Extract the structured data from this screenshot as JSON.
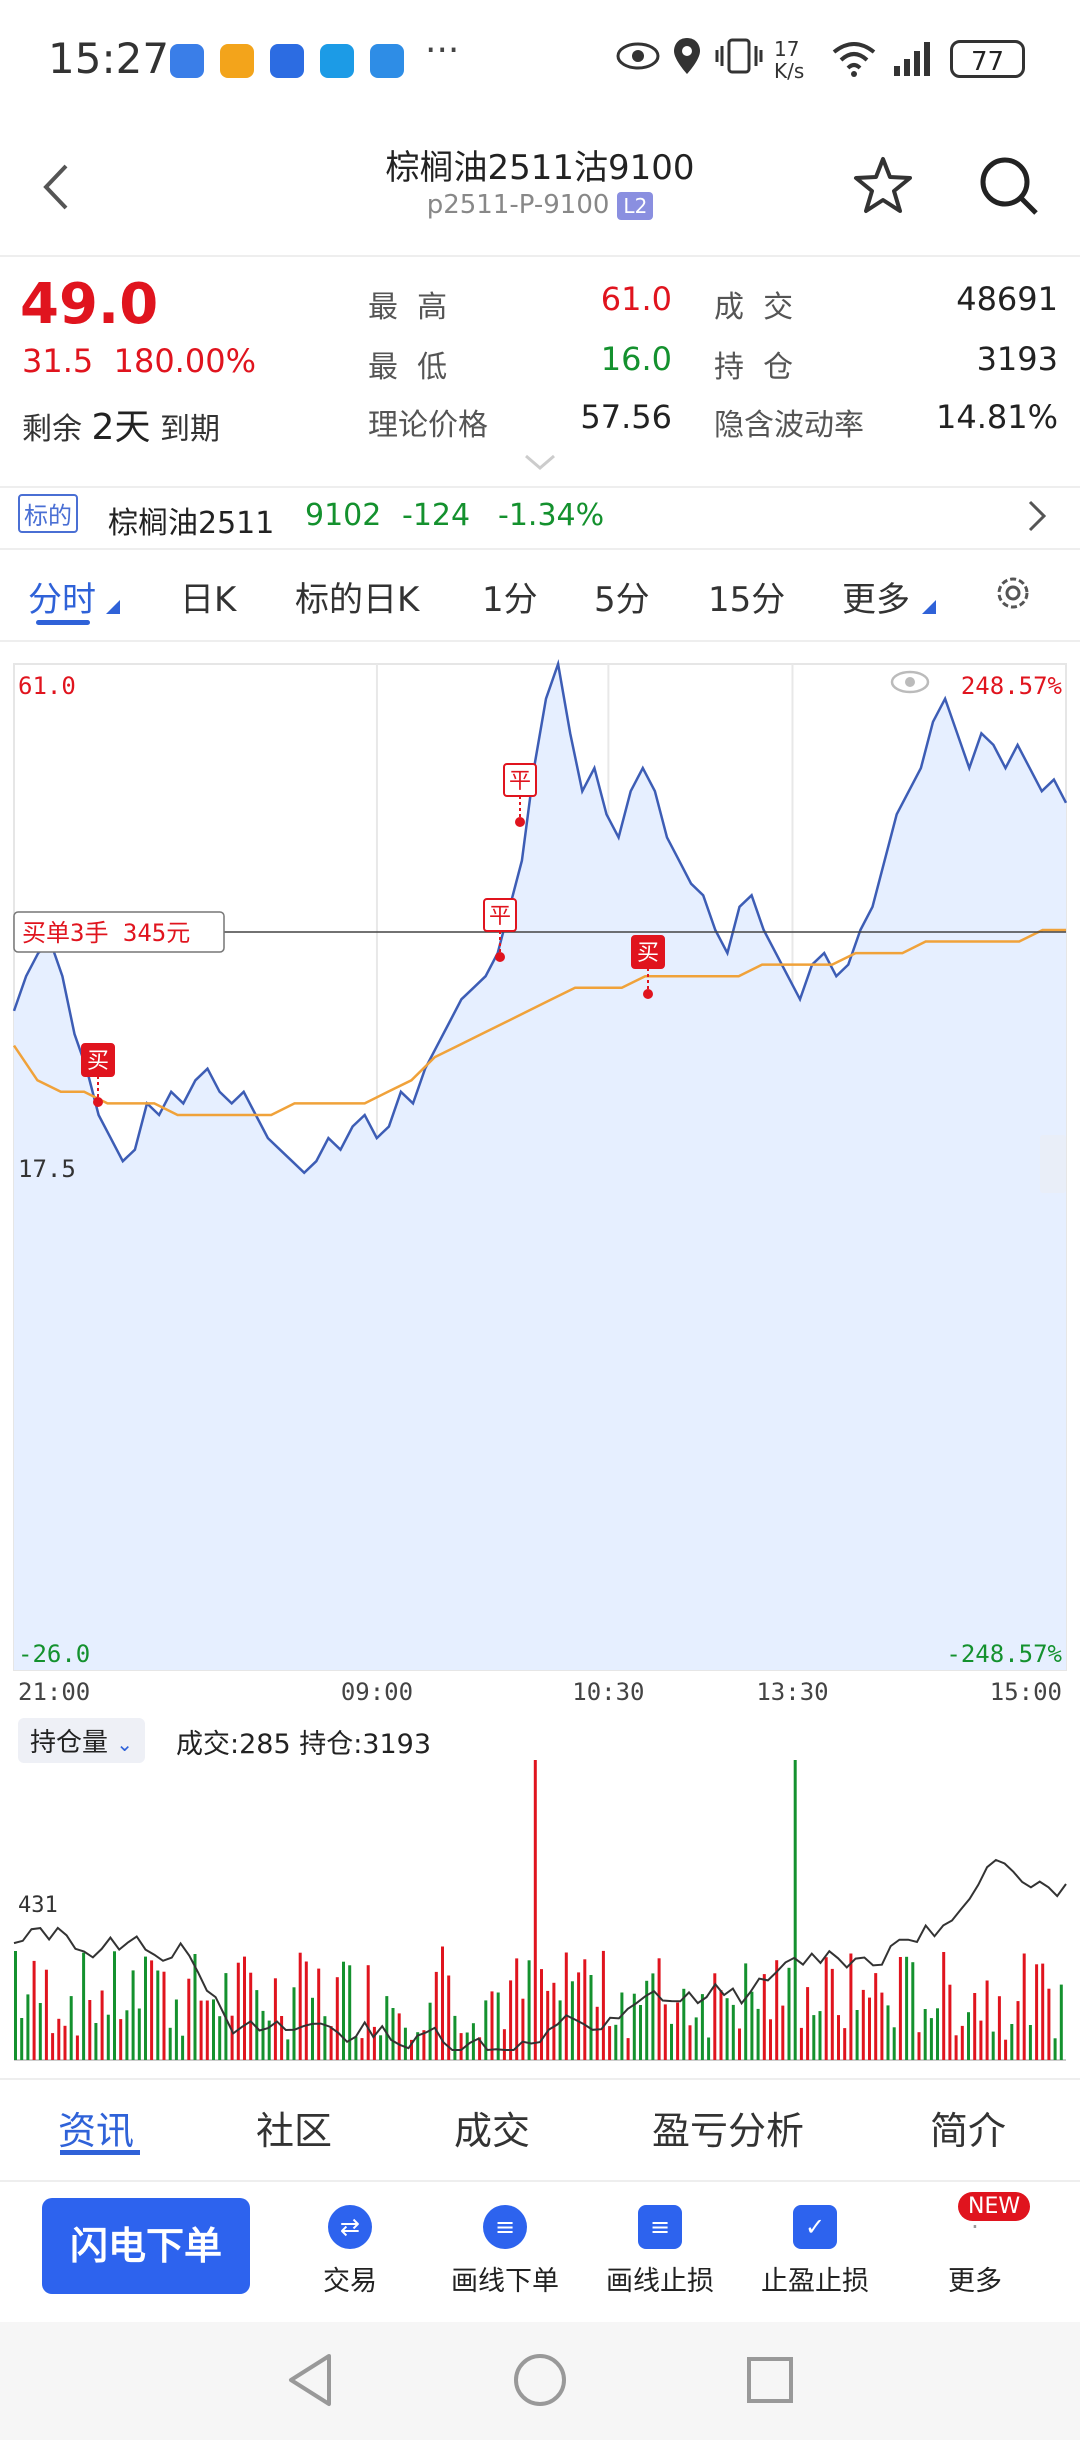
{
  "status_bar": {
    "time": "15:27",
    "more": "···",
    "net_speed": "17 K/s",
    "wifi": "6",
    "battery": "77"
  },
  "header": {
    "title": "棕榈油2511沽9100",
    "code": "p2511-P-9100",
    "badge": "L2"
  },
  "quote": {
    "price": "49.0",
    "change": "31.5",
    "change_pct": "180.00%",
    "remaining_label": "剩余",
    "remaining_value": "2天",
    "expiry_label": "到期",
    "stats": [
      {
        "label": "最  高",
        "value": "61.0",
        "color": "red"
      },
      {
        "label": "成  交",
        "value": "48691",
        "color": "dark"
      },
      {
        "label": "最  低",
        "value": "16.0",
        "color": "green"
      },
      {
        "label": "持  仓",
        "value": "3193",
        "color": "dark"
      },
      {
        "label": "理论价格",
        "value": "57.56",
        "color": "dark"
      },
      {
        "label": "隐含波动率",
        "value": "14.81%",
        "color": "dark"
      }
    ]
  },
  "underlying": {
    "tag": "标的",
    "name": "棕榈油2511",
    "price": "9102",
    "change": "-124",
    "change_pct": "-1.34%"
  },
  "tabs": [
    "分时",
    "日K",
    "标的日K",
    "1分",
    "5分",
    "15分",
    "更多"
  ],
  "chart": {
    "y_top": "61.0",
    "y_mid": "17.5",
    "y_bottom": "-26.0",
    "pct_top": "248.57%",
    "pct_bottom": "-248.57%",
    "x_ticks": [
      "21:00",
      "09:00",
      "10:30",
      "13:30",
      "15:00"
    ],
    "order_label": "买单3手 345元",
    "trade_marks": [
      "买",
      "平",
      "平",
      "买"
    ],
    "colors": {
      "line": "#3d5db5",
      "avg": "#f0a23a",
      "up": "#e0141e",
      "down": "#14912e"
    }
  },
  "chart_data": {
    "type": "line",
    "title": "",
    "xlabel": "",
    "ylabel": "",
    "ylim": [
      -26.0,
      61.0
    ],
    "x_ticks": [
      "21:00",
      "09:00",
      "10:30",
      "13:30",
      "15:00"
    ],
    "series": [
      {
        "values": [
          31,
          34,
          36,
          37,
          34,
          29,
          26,
          22,
          20,
          18,
          19,
          23,
          22,
          24,
          23,
          25,
          26,
          24,
          23,
          24,
          22,
          20,
          19,
          18,
          17,
          18,
          20,
          19,
          21,
          22,
          20,
          21,
          24,
          23,
          26,
          28,
          30,
          32,
          33,
          34,
          36,
          40,
          44,
          52,
          58,
          61,
          55,
          50,
          52,
          48,
          46,
          50,
          52,
          50,
          46,
          44,
          42,
          41,
          38,
          36,
          40,
          41,
          38,
          36,
          34,
          32,
          35,
          36,
          34,
          35,
          38,
          40,
          44,
          48,
          50,
          52,
          56,
          58,
          55,
          52,
          55,
          54,
          52,
          54,
          52,
          50,
          51,
          49
        ]
      },
      {
        "values": [
          28,
          25,
          24,
          24,
          23,
          23,
          23,
          22,
          22,
          22,
          22,
          22,
          23,
          23,
          23,
          23,
          24,
          25,
          27,
          28,
          29,
          30,
          31,
          32,
          33,
          33,
          33,
          34,
          34,
          34,
          34,
          34,
          35,
          35,
          35,
          35,
          36,
          36,
          36,
          37,
          37,
          37,
          37,
          37,
          38,
          38
        ]
      }
    ]
  },
  "volume": {
    "selector": "持仓量",
    "info": "成交:285 持仓:3193",
    "oi_label": "431"
  },
  "bottom_tabs": [
    "资讯",
    "社区",
    "成交",
    "盈亏分析",
    "简介"
  ],
  "actions": {
    "flash": "闪电下单",
    "items": [
      {
        "label": "交易",
        "glyph": "⇄"
      },
      {
        "label": "画线下单",
        "glyph": "≡"
      },
      {
        "label": "画线止损",
        "glyph": "≡"
      },
      {
        "label": "止盈止损",
        "glyph": "✓"
      },
      {
        "label": "更多",
        "glyph": "·"
      }
    ],
    "new_badge": "NEW"
  }
}
